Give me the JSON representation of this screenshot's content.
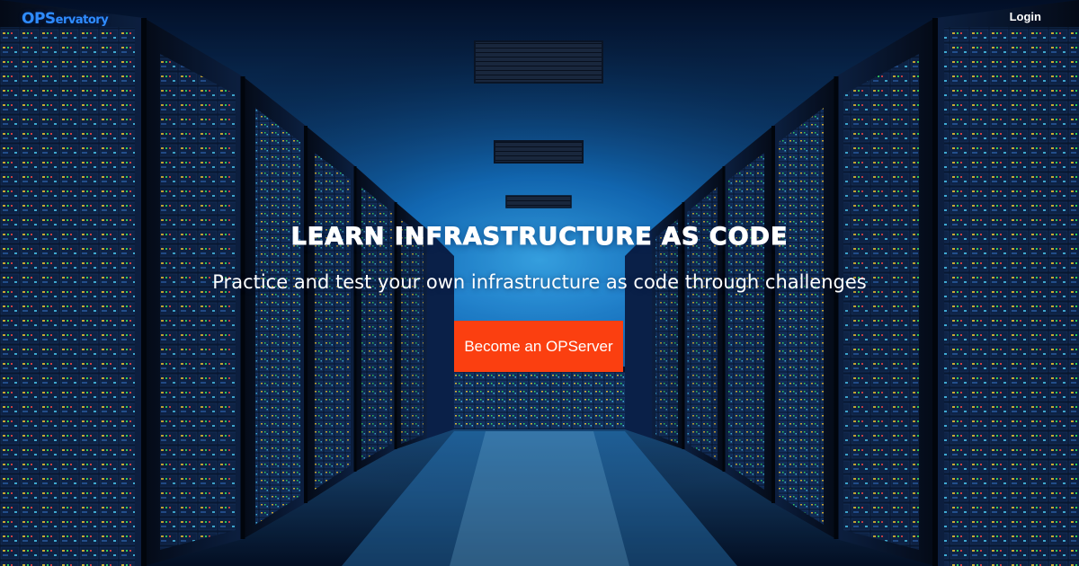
{
  "header": {
    "logo_strong": "OPS",
    "logo_rest": "ervatory",
    "login_label": "Login"
  },
  "hero": {
    "title": "LEARN INFRASTRUCTURE AS CODE",
    "subtitle": "Practice and test your own infrastructure as code through challenges",
    "cta_label": "Become an OPServer"
  },
  "colors": {
    "accent": "#fb3f10",
    "logo": "#2f8cff",
    "text": "#ffffff",
    "background": "#02060f"
  }
}
